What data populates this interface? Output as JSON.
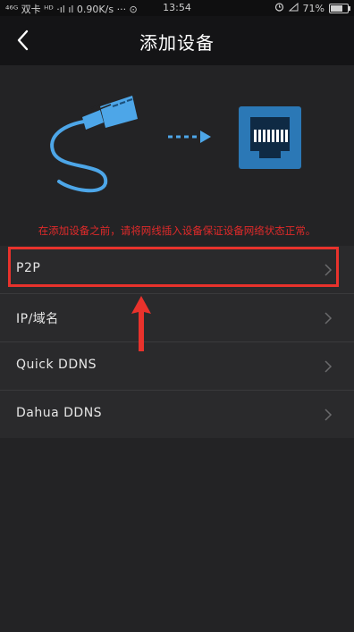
{
  "status_bar": {
    "left_text": "⁴⁶ᴳ 双卡 ᴴᴰ ·ıl ıl 0.90K/s ··· ⊙",
    "time": "13:54",
    "battery": "71%",
    "battery_level": 0.71,
    "icons": [
      "alarm-icon",
      "signal-icon",
      "battery-icon"
    ]
  },
  "header": {
    "title": "添加设备",
    "back_icon": "chevron-left-icon"
  },
  "illustration": {
    "cable_icon": "ethernet-cable-icon",
    "port_icon": "ethernet-port-icon",
    "arrow_icon": "dashed-arrow-right-icon"
  },
  "notice": "在添加设备之前，请将网线插入设备保证设备网络状态正常。",
  "menu": {
    "items": [
      {
        "label": "P2P"
      },
      {
        "label": "IP/域名"
      },
      {
        "label": "Quick DDNS"
      },
      {
        "label": "Dahua DDNS"
      }
    ]
  },
  "colors": {
    "background": "#232325",
    "nav_bar": "#141416",
    "accent_blue": "#4da6e8",
    "port_bg": "#2b78b6",
    "warning_red": "#e02a2a",
    "highlight_red": "#e8322c"
  }
}
